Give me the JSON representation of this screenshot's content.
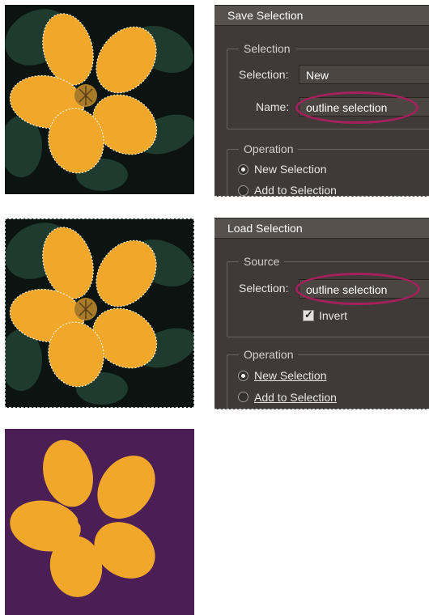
{
  "save_dialog": {
    "title": "Save Selection",
    "selection_group_label": "Selection",
    "selection_label": "Selection:",
    "selection_value": "New",
    "name_label": "Name:",
    "name_value": "outline selection",
    "operation_group_label": "Operation",
    "radio_new": "New Selection",
    "radio_add": "Add to Selection"
  },
  "load_dialog": {
    "title": "Load Selection",
    "source_group_label": "Source",
    "selection_label": "Selection:",
    "selection_value": "outline selection",
    "invert_label": "Invert",
    "invert_checked": true,
    "operation_group_label": "Operation",
    "radio_new": "New Selection",
    "radio_add": "Add to Selection"
  },
  "colors": {
    "flower_petal": "#f1a72a",
    "leaf_dark": "#1f3b2f",
    "photo_bg": "#0c1412",
    "purple_bg": "#4b1f55",
    "highlight": "#a4205a"
  }
}
